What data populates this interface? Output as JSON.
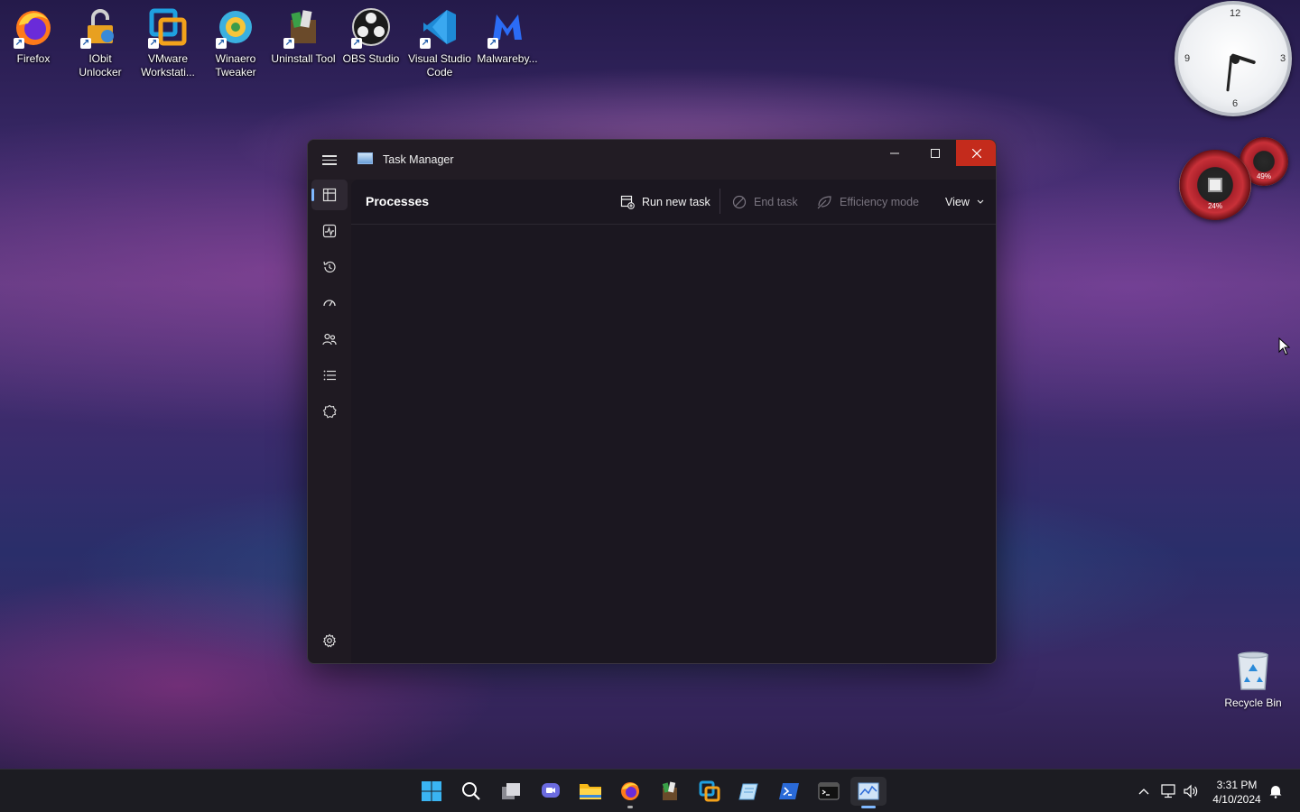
{
  "desktop": {
    "icons": [
      {
        "label": "Firefox",
        "icon": "firefox-icon"
      },
      {
        "label": "IObit\nUnlocker",
        "icon": "iobit-unlocker-icon"
      },
      {
        "label": "VMware\nWorkstati...",
        "icon": "vmware-icon"
      },
      {
        "label": "Winaero\nTweaker",
        "icon": "winaero-icon"
      },
      {
        "label": "Uninstall Tool",
        "icon": "uninstall-tool-icon"
      },
      {
        "label": "OBS Studio",
        "icon": "obs-icon"
      },
      {
        "label": "Visual Studio\nCode",
        "icon": "vscode-icon"
      },
      {
        "label": "Malwareby...",
        "icon": "malwarebytes-icon"
      }
    ],
    "recycle_bin": {
      "label": "Recycle Bin",
      "icon": "recycle-bin-icon"
    }
  },
  "gadgets": {
    "clock": {
      "n12": "12",
      "n3": "3",
      "n6": "6",
      "n9": "9"
    },
    "meter_big": {
      "pct": "24%"
    },
    "meter_small": {
      "pct": "49%"
    }
  },
  "task_manager": {
    "title": "Task Manager",
    "page_title": "Processes",
    "commands": {
      "run_new_task": "Run new task",
      "end_task": "End task",
      "efficiency_mode": "Efficiency mode",
      "view": "View"
    },
    "nav": [
      "processes-icon",
      "performance-icon",
      "app-history-icon",
      "startup-apps-icon",
      "users-icon",
      "details-icon",
      "services-icon",
      "settings-icon"
    ]
  },
  "taskbar": {
    "time": "3:31 PM",
    "date": "4/10/2024"
  },
  "colors": {
    "accent": "#7fb8ff",
    "close_button": "#c42b1c",
    "window_bg": "#1f1a22"
  }
}
